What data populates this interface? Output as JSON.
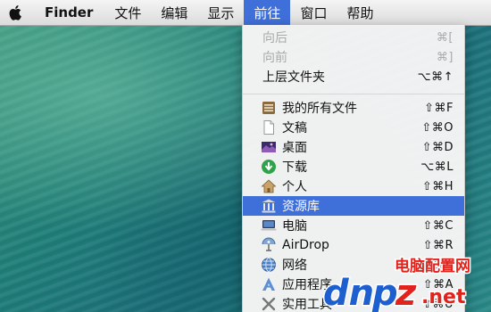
{
  "menubar": {
    "apple_icon": "apple-logo-icon",
    "items": [
      {
        "label": "Finder"
      },
      {
        "label": "文件"
      },
      {
        "label": "编辑"
      },
      {
        "label": "显示"
      },
      {
        "label": "前往"
      },
      {
        "label": "窗口"
      },
      {
        "label": "帮助"
      }
    ]
  },
  "go_menu": {
    "items": [
      {
        "label": "向后",
        "shortcut": "⌘[",
        "disabled": true
      },
      {
        "label": "向前",
        "shortcut": "⌘]",
        "disabled": true
      },
      {
        "label": "上层文件夹",
        "shortcut": "⌥⌘↑"
      },
      {
        "label": "我的所有文件",
        "shortcut": "⇧⌘F",
        "icon": "all-files-icon"
      },
      {
        "label": "文稿",
        "shortcut": "⇧⌘O",
        "icon": "document-icon"
      },
      {
        "label": "桌面",
        "shortcut": "⇧⌘D",
        "icon": "desktop-icon"
      },
      {
        "label": "下载",
        "shortcut": "⌥⌘L",
        "icon": "download-icon"
      },
      {
        "label": "个人",
        "shortcut": "⇧⌘H",
        "icon": "home-icon"
      },
      {
        "label": "资源库",
        "shortcut": "",
        "icon": "library-icon",
        "highlighted": true
      },
      {
        "label": "电脑",
        "shortcut": "⇧⌘C",
        "icon": "computer-icon"
      },
      {
        "label": "AirDrop",
        "shortcut": "⇧⌘R",
        "icon": "airdrop-icon"
      },
      {
        "label": "网络",
        "shortcut": "⇧⌘K",
        "icon": "network-icon"
      },
      {
        "label": "应用程序",
        "shortcut": "⇧⌘A",
        "icon": "applications-icon"
      },
      {
        "label": "实用工具",
        "shortcut": "⇧⌘U",
        "icon": "utilities-icon"
      }
    ]
  },
  "watermark": {
    "site_name": "电脑配置网",
    "logo_text": "dnpz",
    "domain": ".net"
  },
  "colors": {
    "highlight": "#3f6fd8",
    "watermark_blue": "#1e5fd0",
    "watermark_red": "#e0231c"
  }
}
